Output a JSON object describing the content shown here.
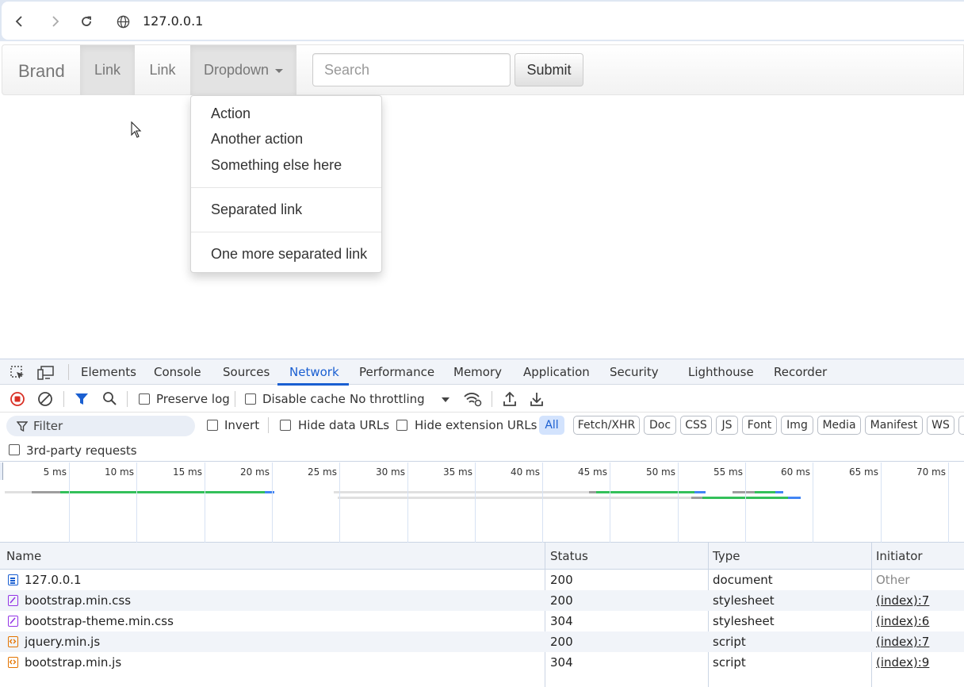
{
  "browser": {
    "url": "127.0.0.1"
  },
  "navbar": {
    "brand": "Brand",
    "links": [
      "Link",
      "Link"
    ],
    "dropdown_label": "Dropdown",
    "search_placeholder": "Search",
    "submit_label": "Submit"
  },
  "dropdown_menu": {
    "items": [
      "Action",
      "Another action",
      "Something else here",
      "Separated link",
      "One more separated link"
    ]
  },
  "devtools": {
    "tabs": [
      "Elements",
      "Console",
      "Sources",
      "Network",
      "Performance",
      "Memory",
      "Application",
      "Security",
      "Lighthouse",
      "Recorder"
    ],
    "active_tab": "Network",
    "toolbar": {
      "preserve_log": "Preserve log",
      "disable_cache": "Disable cache",
      "throttling": "No throttling"
    },
    "filter": {
      "placeholder": "Filter",
      "invert": "Invert",
      "hide_data_urls": "Hide data URLs",
      "hide_extension_urls": "Hide extension URLs",
      "types": [
        "All",
        "Fetch/XHR",
        "Doc",
        "CSS",
        "JS",
        "Font",
        "Img",
        "Media",
        "Manifest",
        "WS"
      ],
      "active_type": "All",
      "third_party": "3rd-party requests"
    },
    "timeline": {
      "ticks": [
        "5 ms",
        "10 ms",
        "15 ms",
        "20 ms",
        "25 ms",
        "30 ms",
        "35 ms",
        "40 ms",
        "45 ms",
        "50 ms",
        "55 ms",
        "60 ms",
        "65 ms",
        "70 ms"
      ]
    },
    "table": {
      "columns": [
        "Name",
        "Status",
        "Type",
        "Initiator"
      ],
      "rows": [
        {
          "name": "127.0.0.1",
          "status": "200",
          "type": "document",
          "initiator": "Other",
          "icon": "document-icon"
        },
        {
          "name": "bootstrap.min.css",
          "status": "200",
          "type": "stylesheet",
          "initiator": "(index):7",
          "icon": "stylesheet-icon"
        },
        {
          "name": "bootstrap-theme.min.css",
          "status": "304",
          "type": "stylesheet",
          "initiator": "(index):6",
          "icon": "stylesheet-icon"
        },
        {
          "name": "jquery.min.js",
          "status": "200",
          "type": "script",
          "initiator": "(index):7",
          "icon": "script-icon"
        },
        {
          "name": "bootstrap.min.js",
          "status": "304",
          "type": "script",
          "initiator": "(index):9",
          "icon": "script-icon"
        }
      ]
    }
  },
  "colors": {
    "accent": "#1a5fd1",
    "doc_icon": "#1a5fd1",
    "css_icon": "#9334e6",
    "js_icon": "#e37400",
    "bar_green": "#34c05a",
    "bar_gray": "#9e9e9e",
    "bar_blue": "#4285f4"
  }
}
